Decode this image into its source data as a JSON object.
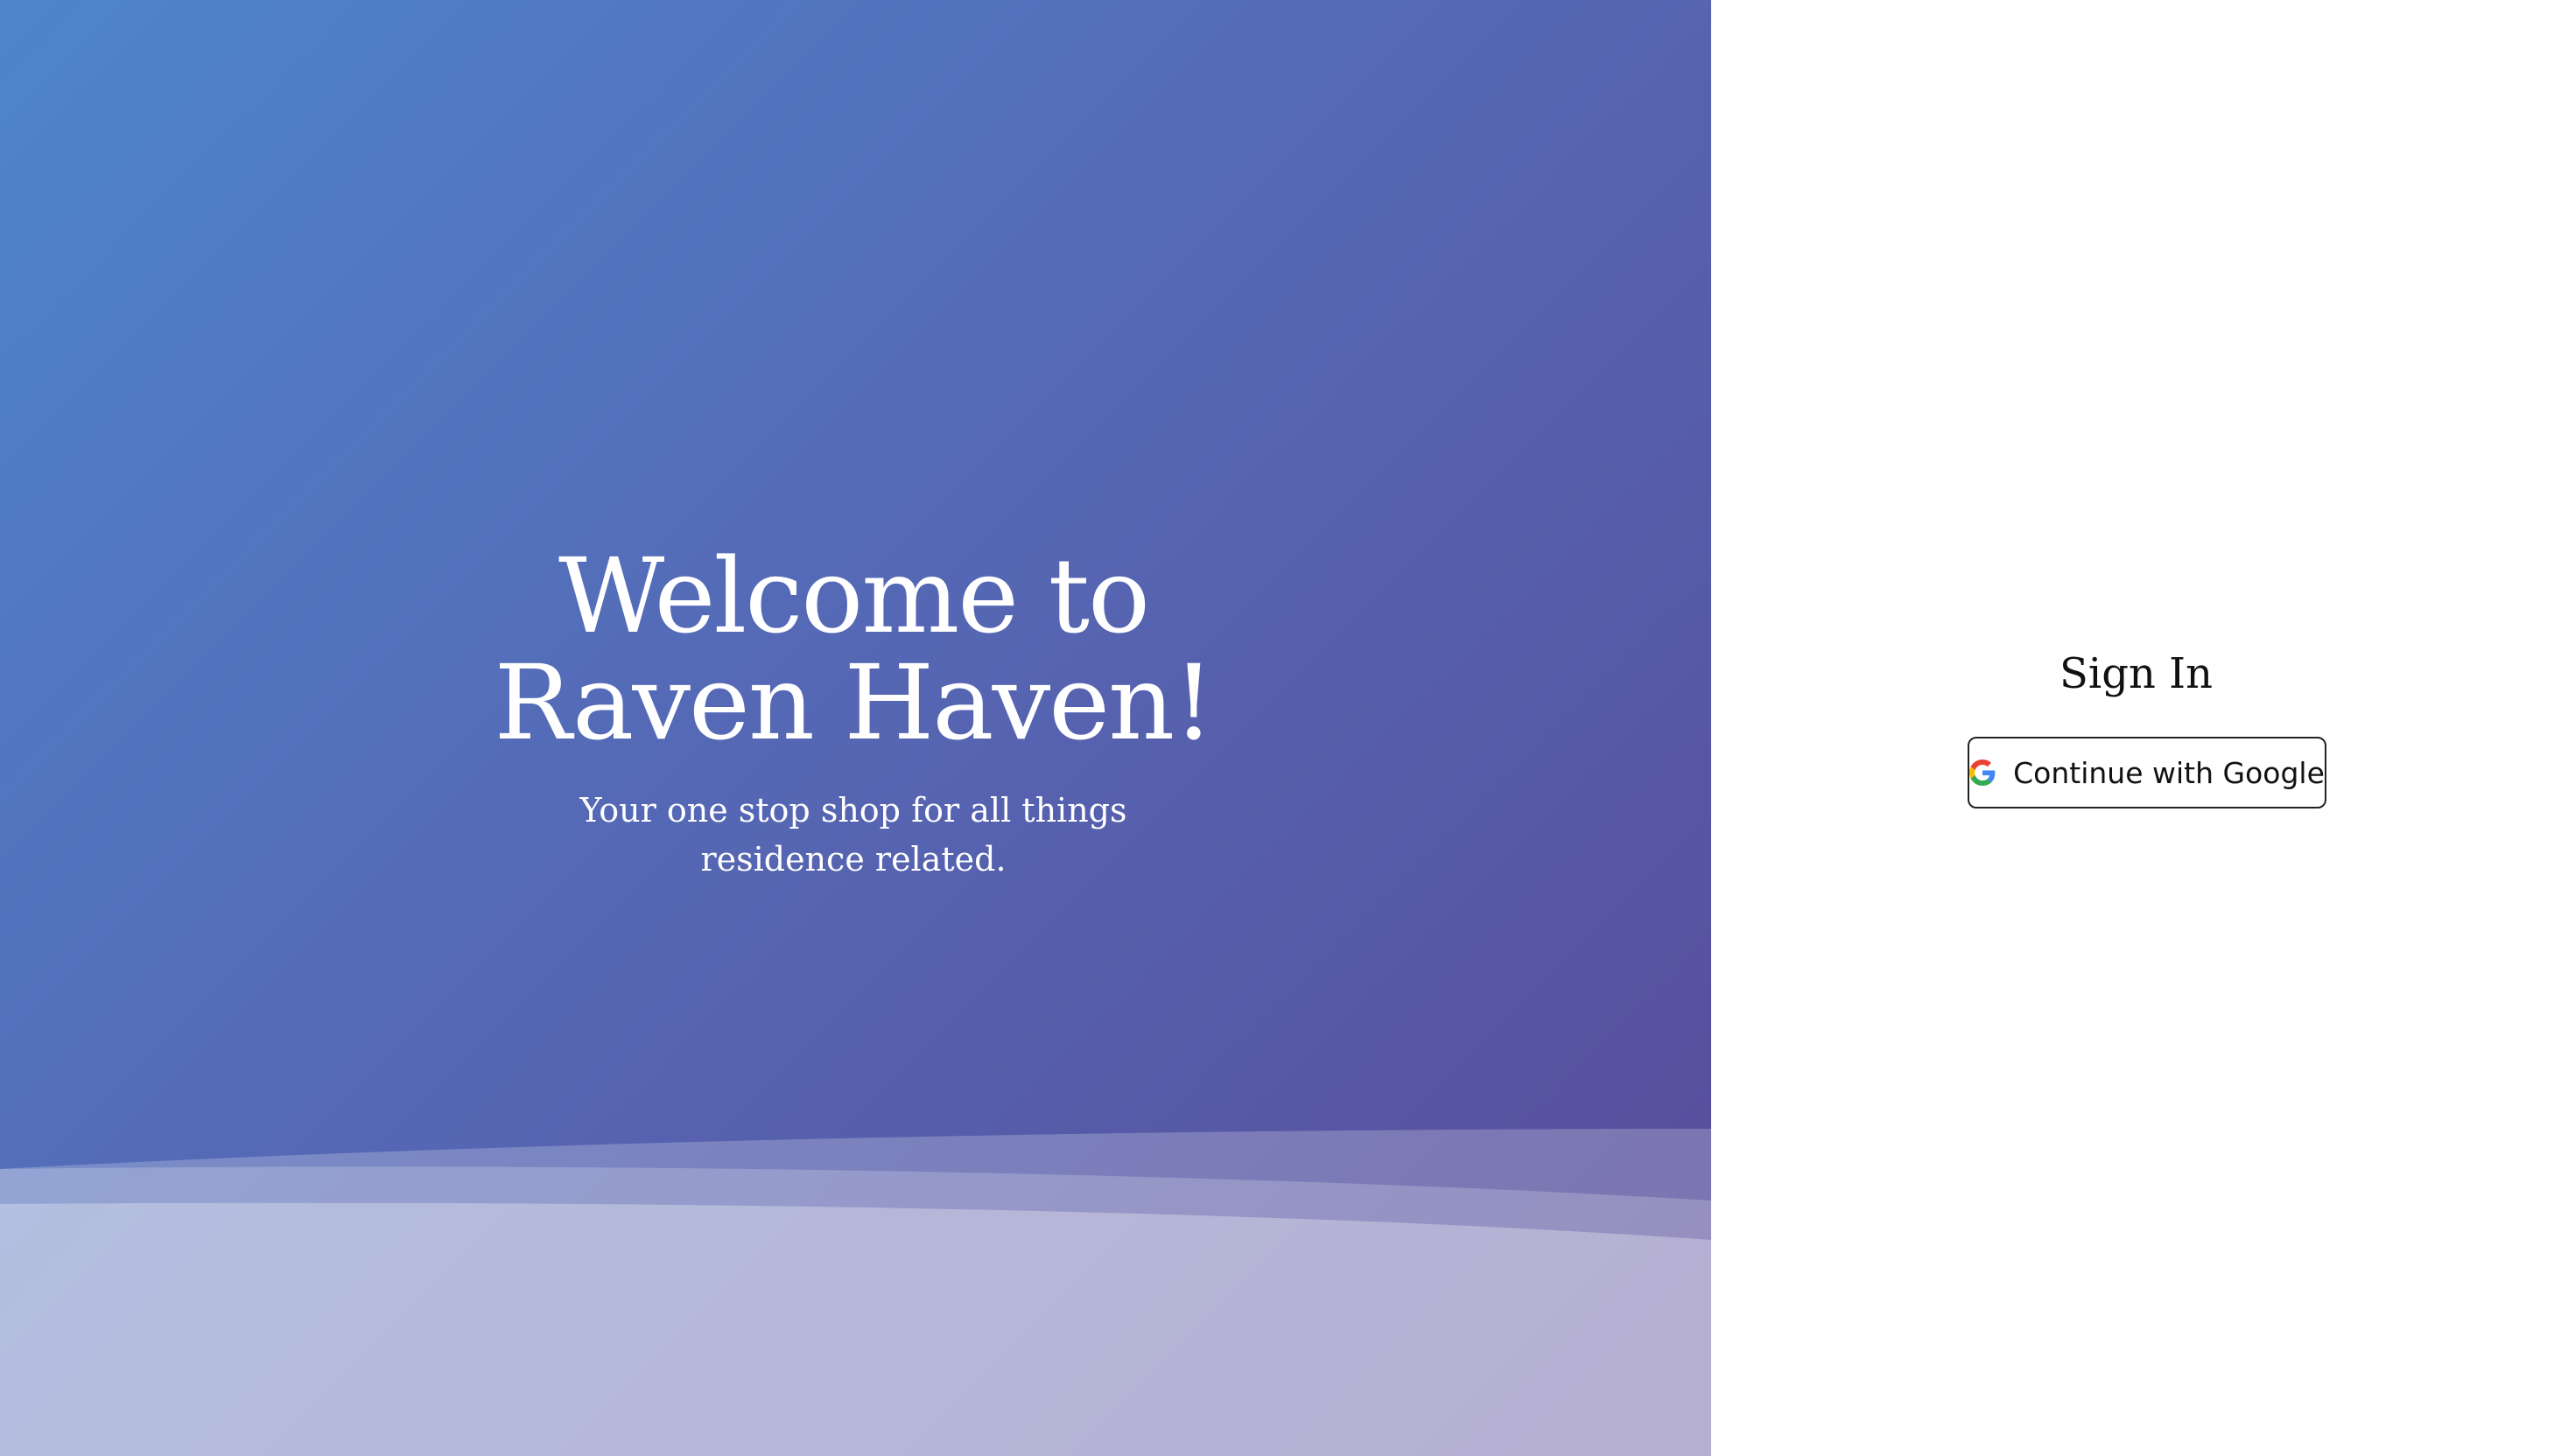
{
  "hero": {
    "title": "Welcome to Raven Haven!",
    "subtitle": "Your one stop shop for all things residence related."
  },
  "signin": {
    "title": "Sign In",
    "google_button_label": "Continue with Google",
    "google_icon": "google-g-icon"
  },
  "colors": {
    "gradient_start": "#4d86ca",
    "gradient_mid": "#5569b6",
    "gradient_end": "#584a97",
    "panel_background": "#ffffff"
  }
}
